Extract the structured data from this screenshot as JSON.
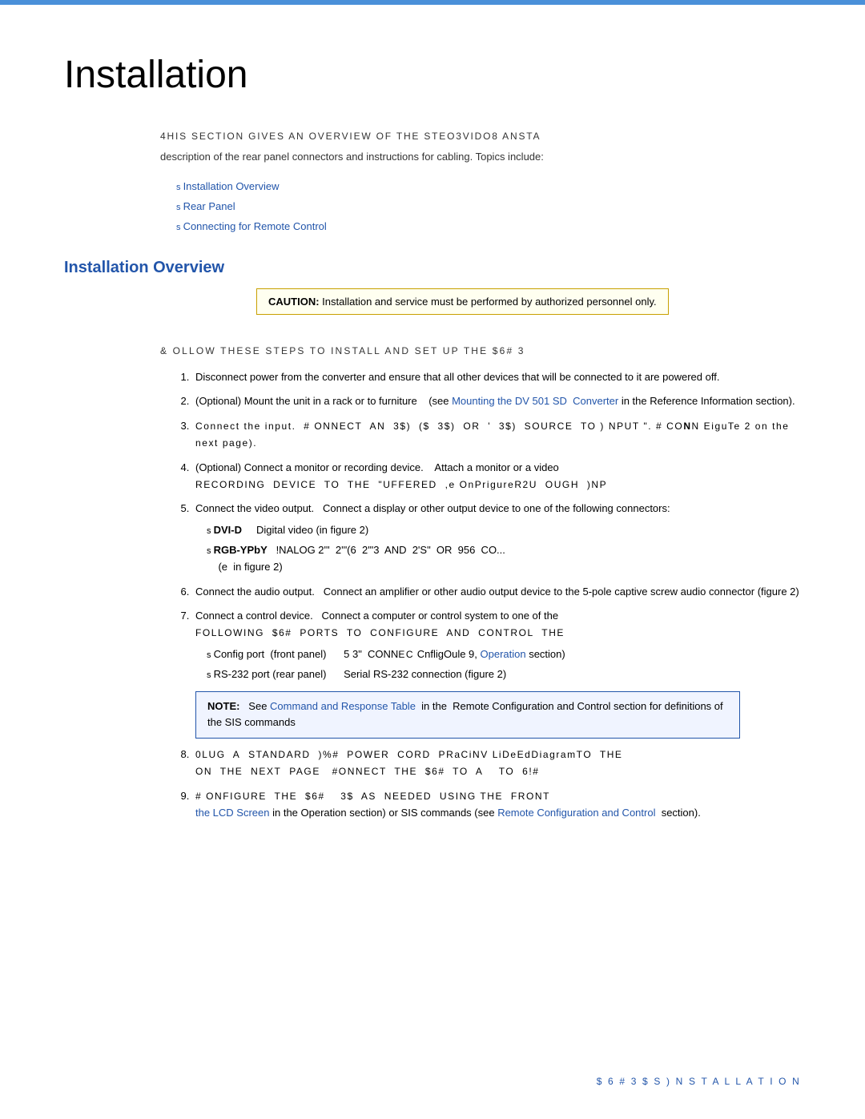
{
  "page": {
    "top_bar_color": "#4a90d9",
    "title": "Installation",
    "intro_spaced": "4HIS SECTION GIVES AN OVERVIEW OF THE STEO3VIDO8 ANSTA",
    "intro_description": "description of the rear panel connectors and instructions for cabling. Topics include:",
    "topics": [
      "Installation Overview",
      "Rear Panel",
      "Connecting for Remote Control"
    ],
    "section_heading": "Installation Overview",
    "caution_label": "CAUTION:",
    "caution_text": "  Installation and service must be performed by authorized personnel only.",
    "steps_header": "& OLLOW THESE STEPS TO INSTALL AND SET UP THE $6#  3",
    "steps": [
      {
        "id": 1,
        "text": "Disconnect power from the converter and ensure that all other devices that will be connected to it are powered off."
      },
      {
        "id": 2,
        "text_before": "(Optional) Mount the unit in a rack or to furniture",
        "text_link1": "Mounting the DV 501 SD  Converter",
        "text_after": " in the Reference Information section).",
        "prefix": "    (see "
      },
      {
        "id": 3,
        "text": "Connect the input.  # ONNECT AN 3$)  ($ 3$)  OR  ' 3$)  SOURCE TO ) NPUT \". # CObNN EiguTe 2 on the next page)."
      },
      {
        "id": 4,
        "text": "(Optional) Connect a monitor or recording device.    Attach a monitor or a video RECORDING DEVICE TO THE \"UFFERED ,e OnPrigureR2U OUGH )NP"
      },
      {
        "id": 5,
        "text_intro": "Connect the video output.   Connect a display or other output device to one of the following connectors:",
        "sub_items": [
          {
            "label": "DVI-D",
            "text": "Digital video (in figure 2)"
          },
          {
            "label": "RGB-YPbY",
            "text": "!NALOG 2'\"  2'\"(6  2'\"3  AND  2'S\"  OR  956  CO ... (e in figure 2)"
          }
        ]
      },
      {
        "id": 6,
        "text": "Connect the audio output.   Connect an amplifier or other audio output device to the 5-pole captive screw audio connector (figure 2)"
      },
      {
        "id": 7,
        "text_intro": "Connect a control device.   Connect a computer or control system to one of the FOLLOWING $6# PORTS TO CONFIGURE AND CONTROL THE",
        "sub_items": [
          {
            "label": "Config port  (front panel)",
            "text": "5 3\"  CONNEC CnfligOule 9, Operation section)"
          },
          {
            "label": "RS-232 port (rear panel)",
            "text": "Serial RS-232 connection (figure 2)"
          }
        ],
        "note": {
          "label": "NOTE:",
          "text_before": "  See ",
          "link": "Command and Response Table",
          "text_after": "  in the  Remote Configuration and Control section for definitions of the SIS commands"
        }
      },
      {
        "id": 8,
        "text": "0LUG  A  STANDARD  )%#  POWER  CORD  PRaCiNV LiDeEdDiagramTO  THE ON  THE  NEXT  PAGE   #ONNECT  THE  $6#  TO  A    TO  6!#"
      },
      {
        "id": 9,
        "text_intro": "# ONFIGURE  THE  $6#   3$  AS  NEEDED  USING THE  FRONT",
        "text_link1": "the LCD Screen",
        "text_mid": " in the Operation section) or SIS commands (see ",
        "text_link2": "Remote Configuration and Control",
        "text_end": "  section)."
      }
    ],
    "footer": "$ 6 #    3 $  s  ) N S T A L L A T I O N"
  }
}
